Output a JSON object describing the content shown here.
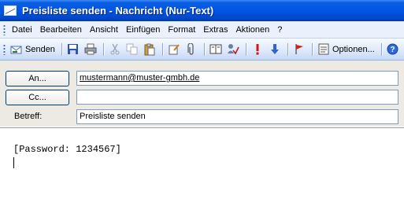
{
  "window": {
    "title": "Preisliste senden - Nachricht (Nur-Text)"
  },
  "menu": [
    "Datei",
    "Bearbeiten",
    "Ansicht",
    "Einfügen",
    "Format",
    "Extras",
    "Aktionen",
    "?"
  ],
  "toolbar": {
    "send_label": "Senden",
    "options_label": "Optionen..."
  },
  "headers": {
    "to_button": "An...",
    "to_value": "mustermann@muster-gmbh.de",
    "cc_button": "Cc...",
    "cc_value": "",
    "subject_label": "Betreff:",
    "subject_value": "Preisliste senden"
  },
  "message": {
    "body": "[Password: 1234567]"
  }
}
